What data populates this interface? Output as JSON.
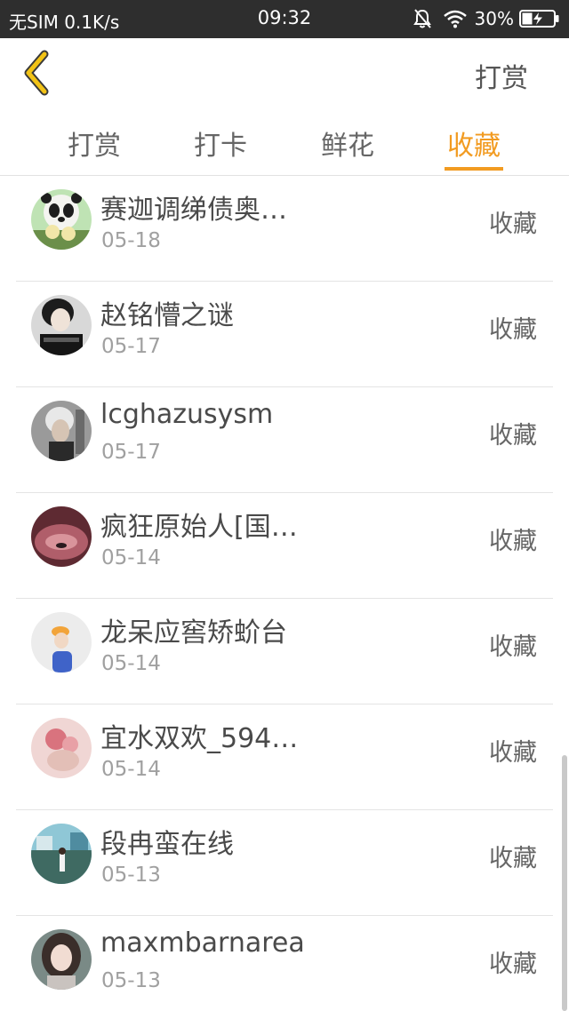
{
  "status_bar": {
    "carrier": "无SIM 0.1K/s",
    "time": "09:32",
    "battery": "30%"
  },
  "nav": {
    "action_label": "打赏",
    "accent_color": "#f29b21"
  },
  "tabs": [
    {
      "label": "打赏",
      "active": false
    },
    {
      "label": "打卡",
      "active": false
    },
    {
      "label": "鲜花",
      "active": false
    },
    {
      "label": "收藏",
      "active": true
    }
  ],
  "items": [
    {
      "name": "赛迦调绨债奥…",
      "date": "05-18",
      "action": "收藏"
    },
    {
      "name": "赵铭懵之谜",
      "date": "05-17",
      "action": "收藏"
    },
    {
      "name": "lcghazusysm",
      "date": "05-17",
      "action": "收藏"
    },
    {
      "name": "疯狂原始人[国…",
      "date": "05-14",
      "action": "收藏"
    },
    {
      "name": "龙呆应窖矫蚧台",
      "date": "05-14",
      "action": "收藏"
    },
    {
      "name": "宜水双欢_594…",
      "date": "05-14",
      "action": "收藏"
    },
    {
      "name": "段冉蛮在线",
      "date": "05-13",
      "action": "收藏"
    },
    {
      "name": "maxmbarnarea",
      "date": "05-13",
      "action": "收藏"
    }
  ]
}
